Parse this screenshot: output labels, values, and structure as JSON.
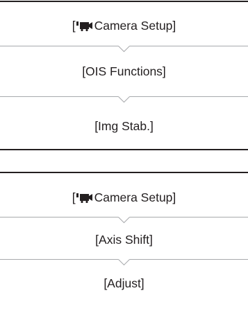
{
  "procedure_a": {
    "steps": [
      {
        "text": "Camera Setup]",
        "prefix": "[",
        "icon": "movie-camera-icon"
      },
      {
        "text": "[OIS Functions]"
      },
      {
        "text": "[Img Stab.]"
      }
    ]
  },
  "procedure_b": {
    "steps": [
      {
        "text": "Camera Setup]",
        "prefix": "[",
        "icon": "movie-camera-icon"
      },
      {
        "text": "[Axis Shift]"
      },
      {
        "text": "[Adjust]"
      }
    ]
  }
}
